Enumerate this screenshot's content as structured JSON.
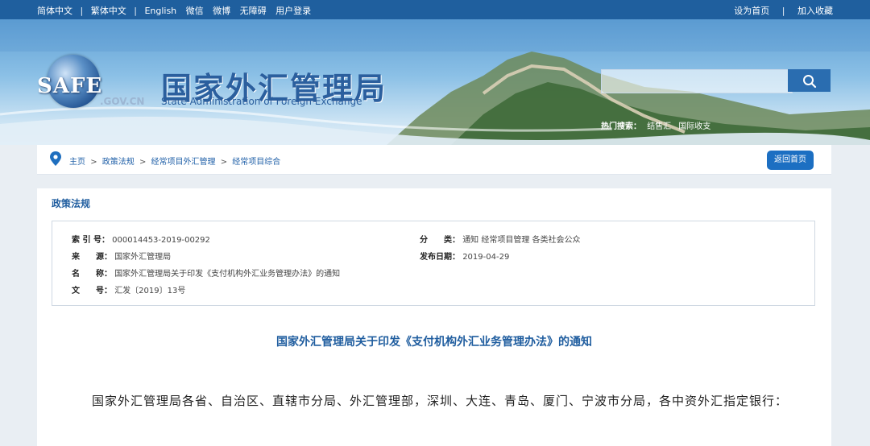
{
  "topbar": {
    "simplified": "简体中文",
    "traditional": "繁体中文",
    "english": "English",
    "wechat": "微信",
    "weibo": "微博",
    "accessibility": "无障碍",
    "login": "用户登录",
    "set_home": "设为首页",
    "favorite": "加入收藏",
    "separator": "|"
  },
  "logo": {
    "mark": "SAFE",
    "domain": ".GOV.CN",
    "title_cn": "国家外汇管理局",
    "title_en": "State Administration of Foreign Exchange"
  },
  "search": {
    "placeholder": "",
    "button_icon": "search-icon",
    "hot_label": "热门搜索：",
    "hot_items": [
      "结售汇",
      "国际收支"
    ]
  },
  "breadcrumb": {
    "items": [
      "主页",
      "政策法规",
      "经常项目外汇管理",
      "经常项目综合"
    ],
    "arrow": ">",
    "back_home": "返回首页"
  },
  "section": {
    "title": "政策法规"
  },
  "meta": {
    "index_label": "索 引 号：",
    "index_value": "000014453-2019-00292",
    "source_label": "来　　源：",
    "source_value": "国家外汇管理局",
    "name_label": "名　　称：",
    "name_value": "国家外汇管理局关于印发《支付机构外汇业务管理办法》的通知",
    "docno_label": "文　　号：",
    "docno_value": "汇发〔2019〕13号",
    "category_label": "分　　类：",
    "category_value": "通知 经常项目管理 各类社会公众",
    "date_label": "发布日期：",
    "date_value": "2019-04-29"
  },
  "document": {
    "title": "国家外汇管理局关于印发《支付机构外汇业务管理办法》的通知",
    "paragraph": "国家外汇管理局各省、自治区、直辖市分局、外汇管理部，深圳、大连、青岛、厦门、宁波市分局，各中资外汇指定银行："
  },
  "colors": {
    "brand_blue": "#1f5f9e",
    "link_blue": "#2060a8",
    "button_blue": "#1c6fc2"
  }
}
